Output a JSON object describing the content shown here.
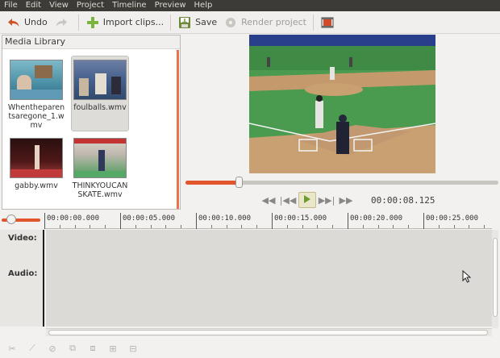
{
  "menubar": {
    "items": [
      "File",
      "Edit",
      "View",
      "Project",
      "Timeline",
      "Preview",
      "Help"
    ]
  },
  "toolbar": {
    "undo_label": "Undo",
    "import_label": "Import clips...",
    "save_label": "Save",
    "render_label": "Render project"
  },
  "library": {
    "title": "Media Library",
    "clips": [
      {
        "name": "Whentheparentsaregone_1.wmv",
        "display": "Whentheparentsaregone_1.wmv"
      },
      {
        "name": "foulballs.wmv",
        "display": "foulballs.wmv"
      },
      {
        "name": "gabby.wmv",
        "display": "gabby.wmv"
      },
      {
        "name": "THINKYOUCANSKATE.wmv",
        "display": "THINKYOUCANSKATE.wmv"
      }
    ]
  },
  "viewer": {
    "progress": 0.17,
    "timecode": "00:00:08.125"
  },
  "timeline": {
    "ticks": [
      "00:00:00.000",
      "00:00:05.000",
      "00:00:10.000",
      "00:00:15.000",
      "00:00:20.000",
      "00:00:25.000"
    ],
    "tracks": [
      "Video:",
      "Audio:"
    ]
  },
  "colors": {
    "accent": "#e2552c",
    "menubar_bg": "#3c3b37"
  }
}
